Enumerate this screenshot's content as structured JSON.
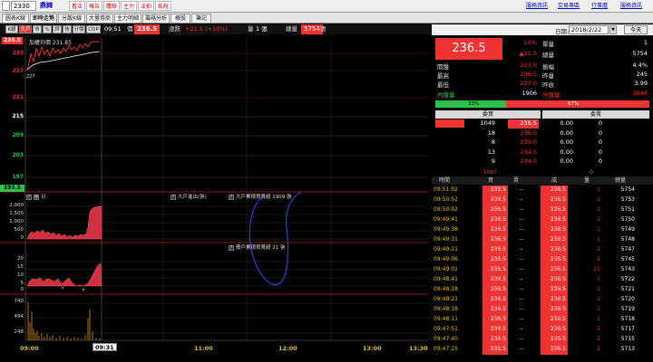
{
  "topbar": {
    "stock_code": "2330",
    "stock_name": "鼎錡",
    "tool_buttons": [
      "看法",
      "報告",
      "體檢",
      "主力",
      "法拍",
      "亂稅"
    ],
    "links": [
      "服務資訊",
      "交易專區",
      "行事曆",
      "服務資訊"
    ]
  },
  "tabs": [
    "圖表K線",
    "即時走勢",
    "分散K線",
    "大量券商",
    "主力明細",
    "籌碼分析",
    "概股",
    "筆記"
  ],
  "toolbar": {
    "buttons": [
      "K線",
      "大戶",
      "市",
      "%",
      "評",
      "技",
      "分價",
      "CDP"
    ],
    "time": "09:51",
    "price_label": "價",
    "price": "236.5",
    "change_label": "漲跌",
    "change": "+21.5 (+10%)",
    "volume_label": "量",
    "volume": "1 張",
    "total_label": "總量",
    "total": "5754",
    "total_unit": "張"
  },
  "chart": {
    "price_badge": "236.5",
    "avg_label": "加權均價 231.85",
    "y_labels": [
      {
        "text": "233",
        "color": "red"
      },
      {
        "text": "227",
        "color": "red"
      },
      {
        "text": "221",
        "color": "red"
      },
      {
        "text": "215",
        "color": "white"
      },
      {
        "text": "209",
        "color": "green"
      },
      {
        "text": "203",
        "color": "green"
      },
      {
        "text": "197",
        "color": "green"
      },
      {
        "text": "193.5",
        "color": "green"
      }
    ],
    "low_marker": "227",
    "panel2": {
      "header_left": "日",
      "header_mid": "大戶進出(張)",
      "header_right": "大戶累積買賣超 1909 張",
      "labels": [
        "2,000",
        "1,500",
        "1,000",
        "500",
        "0"
      ]
    },
    "panel3": {
      "header": "散戶累積買賣超 21 張",
      "labels": [
        "20",
        "15",
        "10",
        "5",
        "0",
        "-5"
      ]
    },
    "panel4": {
      "labels": [
        "740",
        "494",
        "248"
      ]
    },
    "x_labels": [
      "09:00",
      "09:31",
      "11:00",
      "12:00",
      "13:00",
      "13:30"
    ]
  },
  "right": {
    "date_label": "日期:",
    "date": "2018/2/22",
    "today_button": "今天",
    "price": "236.5",
    "pct": "10%",
    "change": "▲21.5",
    "unit_vol_label": "單量",
    "unit_vol": "1",
    "total_vol_label": "總量",
    "total_vol": "5754",
    "stats": [
      {
        "label": "開盤",
        "value": "227.0",
        "label2": "振幅",
        "value2": "4.4%"
      },
      {
        "label": "最高",
        "value": "236.5",
        "label2": "昨量",
        "value2": "245"
      },
      {
        "label": "最低",
        "value": "227.0",
        "label2": "昨收",
        "value2": "3.99"
      }
    ],
    "inner_label": "內盤量",
    "inner_value": "1906",
    "outer_label": "外盤量",
    "outer_value": "3848",
    "bar_left_pct": "33%",
    "bar_right_pct": "67%",
    "bar_left_frac": 0.33,
    "bid_header": "委買",
    "ask_header": "委賣",
    "book": [
      {
        "bid_qty": "1049",
        "bid": "236.5",
        "ask": "0.00",
        "ask_qty": "0"
      },
      {
        "bid_qty": "18",
        "bid": "236.0",
        "ask": "0.00",
        "ask_qty": "0"
      },
      {
        "bid_qty": "8",
        "bid": "235.0",
        "ask": "0.00",
        "ask_qty": "0"
      },
      {
        "bid_qty": "13",
        "bid": "234.5",
        "ask": "0.00",
        "ask_qty": "0"
      },
      {
        "bid_qty": "9",
        "bid": "234.0",
        "ask": "0.00",
        "ask_qty": "0"
      }
    ],
    "book_total_bid": "1097",
    "book_total_ask": "0",
    "tick_headers": [
      "時間",
      "買",
      "賣",
      "成",
      "量",
      "總量"
    ],
    "ticks": [
      {
        "time": "09:51:02",
        "bid": "236.5",
        "ask": "--",
        "price": "236.5",
        "vol": "1",
        "total": "5754"
      },
      {
        "time": "09:50:52",
        "bid": "236.5",
        "ask": "--",
        "price": "236.5",
        "vol": "2",
        "total": "5753"
      },
      {
        "time": "09:50:02",
        "bid": "236.5",
        "ask": "--",
        "price": "236.5",
        "vol": "1",
        "total": "5751"
      },
      {
        "time": "09:49:41",
        "bid": "236.5",
        "ask": "--",
        "price": "236.5",
        "vol": "1",
        "total": "5750"
      },
      {
        "time": "09:49:38",
        "bid": "236.5",
        "ask": "--",
        "price": "236.5",
        "vol": "1",
        "total": "5749"
      },
      {
        "time": "09:49:31",
        "bid": "236.5",
        "ask": "--",
        "price": "236.5",
        "vol": "1",
        "total": "5748"
      },
      {
        "time": "09:49:21",
        "bid": "236.5",
        "ask": "--",
        "price": "236.5",
        "vol": "2",
        "total": "5747"
      },
      {
        "time": "09:49:06",
        "bid": "236.5",
        "ask": "--",
        "price": "236.5",
        "vol": "2",
        "total": "5745"
      },
      {
        "time": "09:49:01",
        "bid": "236.5",
        "ask": "--",
        "price": "236.5",
        "vol": "21",
        "total": "5743"
      },
      {
        "time": "09:48:41",
        "bid": "236.5",
        "ask": "--",
        "price": "236.5",
        "vol": "1",
        "total": "5722"
      },
      {
        "time": "09:48:28",
        "bid": "236.5",
        "ask": "--",
        "price": "236.5",
        "vol": "1",
        "total": "5721"
      },
      {
        "time": "09:48:21",
        "bid": "236.5",
        "ask": "--",
        "price": "236.5",
        "vol": "1",
        "total": "5720"
      },
      {
        "time": "09:48:16",
        "bid": "236.5",
        "ask": "--",
        "price": "236.5",
        "vol": "1",
        "total": "5719"
      },
      {
        "time": "09:48:11",
        "bid": "236.5",
        "ask": "--",
        "price": "236.5",
        "vol": "1",
        "total": "5718"
      },
      {
        "time": "09:47:51",
        "bid": "236.5",
        "ask": "--",
        "price": "236.5",
        "vol": "2",
        "total": "5717"
      },
      {
        "time": "09:47:40",
        "bid": "236.5",
        "ask": "--",
        "price": "236.5",
        "vol": "2",
        "total": "5715"
      },
      {
        "time": "09:47:25",
        "bid": "236.5",
        "ask": "--",
        "price": "236.5",
        "vol": "2",
        "total": "5713"
      }
    ]
  }
}
